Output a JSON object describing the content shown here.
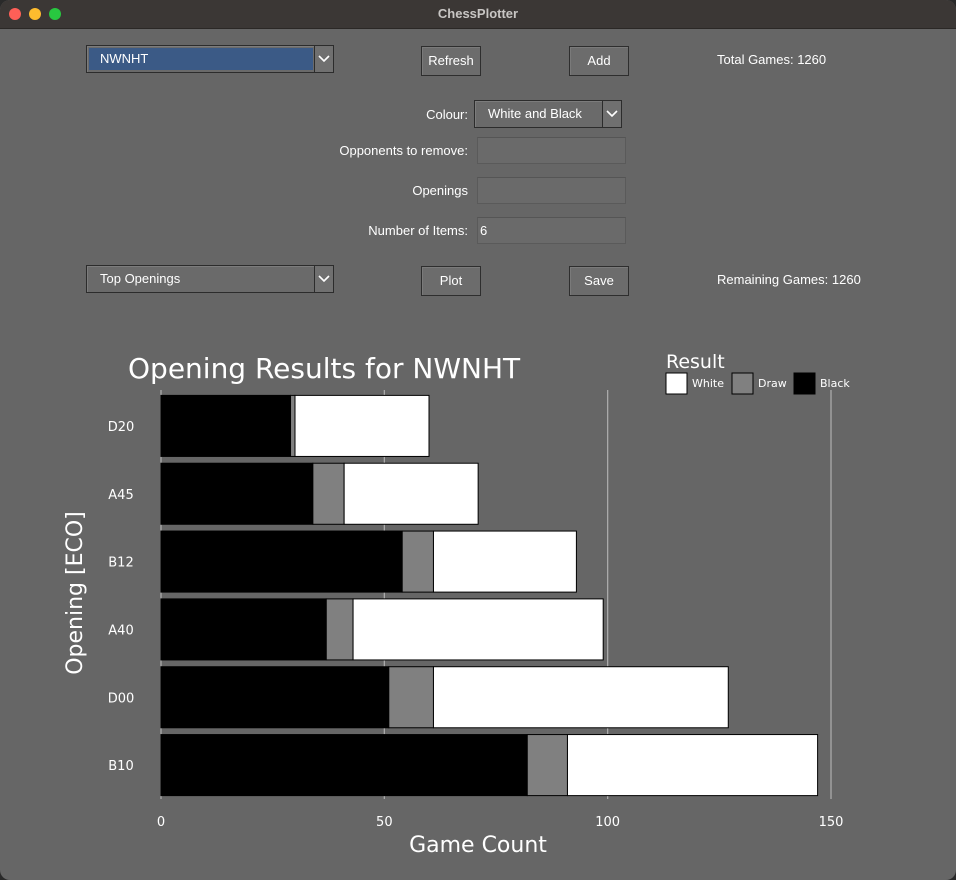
{
  "window": {
    "title": "ChessPlotter"
  },
  "controls": {
    "player_select": "NWNHT",
    "refresh_label": "Refresh",
    "add_label": "Add",
    "total_games": "Total Games: 1260",
    "colour_label": "Colour:",
    "colour_select": "White and Black",
    "opponents_label": "Opponents to remove:",
    "opponents_value": "",
    "openings_label": "Openings",
    "openings_value": "",
    "items_label": "Number of Items:",
    "items_value": "6",
    "plot_type_select": "Top Openings",
    "plot_label": "Plot",
    "save_label": "Save",
    "remaining_games": "Remaining Games: 1260"
  },
  "chart_data": {
    "type": "bar",
    "orientation": "horizontal",
    "stacked": true,
    "title": "Opening Results for NWNHT",
    "xlabel": "Game Count",
    "ylabel": "Opening [ECO]",
    "xlim": [
      0,
      150
    ],
    "xticks": [
      0,
      50,
      100,
      150
    ],
    "grid": true,
    "legend": {
      "title": "Result",
      "placement": "top-right"
    },
    "categories": [
      "D20",
      "A45",
      "B12",
      "A40",
      "D00",
      "B10"
    ],
    "series": [
      {
        "name": "Black",
        "color": "#000000",
        "values": [
          29,
          34,
          54,
          37,
          51,
          82
        ]
      },
      {
        "name": "Draw",
        "color": "#808080",
        "values": [
          1,
          7,
          7,
          6,
          10,
          9
        ]
      },
      {
        "name": "White",
        "color": "#ffffff",
        "values": [
          30,
          30,
          32,
          56,
          66,
          56
        ]
      }
    ]
  }
}
